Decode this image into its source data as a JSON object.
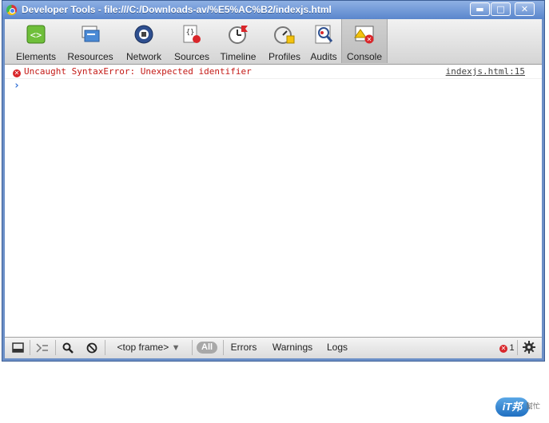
{
  "window": {
    "title": "Developer Tools - file:///C:/Downloads-av/%E5%AC%B2/indexjs.html",
    "buttons": {
      "minimize": "▬",
      "maximize": "□",
      "close": "✕"
    }
  },
  "toolbar": {
    "tabs": [
      {
        "label": "Elements",
        "icon": "elements-icon"
      },
      {
        "label": "Resources",
        "icon": "resources-icon"
      },
      {
        "label": "Network",
        "icon": "network-icon"
      },
      {
        "label": "Sources",
        "icon": "sources-icon"
      },
      {
        "label": "Timeline",
        "icon": "timeline-icon"
      },
      {
        "label": "Profiles",
        "icon": "profiles-icon"
      },
      {
        "label": "Audits",
        "icon": "audits-icon"
      },
      {
        "label": "Console",
        "icon": "console-icon",
        "active": true
      }
    ]
  },
  "console": {
    "messages": [
      {
        "level": "error",
        "text": "Uncaught SyntaxError: Unexpected identifier",
        "source": "indexjs.html:15"
      }
    ],
    "prompt": "›"
  },
  "statusbar": {
    "frame_select": "<top frame>",
    "filters": {
      "all": "All",
      "errors": "Errors",
      "warnings": "Warnings",
      "logs": "Logs"
    },
    "error_count": "1"
  },
  "watermark": {
    "badge": "iT邦",
    "sub": "幫忙"
  },
  "colors": {
    "title_bar": "#6b8fc7",
    "error_text": "#c41a16",
    "prompt": "#2f6fd6",
    "error_icon": "#d9262a"
  }
}
